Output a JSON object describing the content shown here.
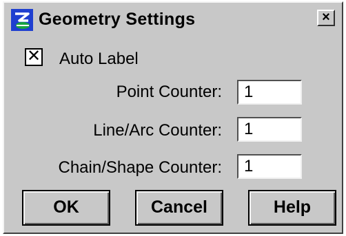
{
  "window": {
    "title": "Geometry Settings",
    "close_glyph": "×",
    "app_icon": "microstation-icon"
  },
  "auto_label": {
    "label": "Auto Label",
    "checked": true,
    "check_glyph": "✕"
  },
  "fields": [
    {
      "label": "Point Counter:",
      "value": "1"
    },
    {
      "label": "Line/Arc Counter:",
      "value": "1"
    },
    {
      "label": "Chain/Shape Counter:",
      "value": "1"
    }
  ],
  "buttons": {
    "ok": "OK",
    "cancel": "Cancel",
    "help": "Help"
  },
  "colors": {
    "dialog_bg": "#c8c8c8",
    "icon_blue": "#1f3fd0",
    "icon_green": "#19a340"
  }
}
